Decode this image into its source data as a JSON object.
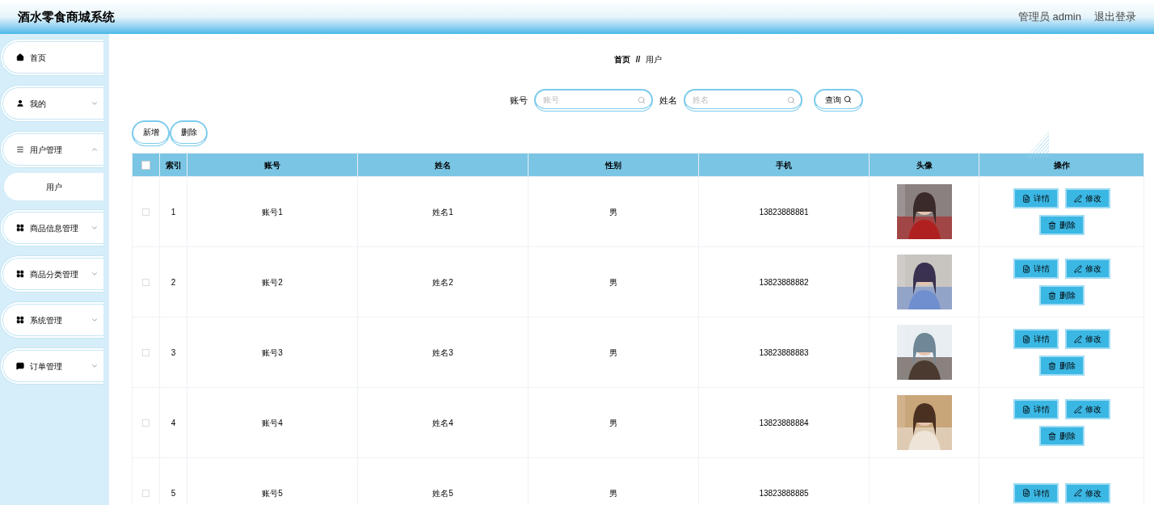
{
  "header": {
    "title": "酒水零食商城系统",
    "user": "管理员 admin",
    "logout": "退出登录"
  },
  "sidebar": {
    "items": [
      {
        "label": "首页"
      },
      {
        "label": "我的",
        "expanded": false
      },
      {
        "label": "用户管理",
        "expanded": true,
        "children": [
          {
            "label": "用户",
            "selected": true
          }
        ]
      },
      {
        "label": "商品信息管理",
        "expanded": false
      },
      {
        "label": "商品分类管理",
        "expanded": false
      },
      {
        "label": "系统管理",
        "expanded": false
      },
      {
        "label": "订单管理",
        "expanded": false
      }
    ]
  },
  "breadcrumb": [
    "首页",
    "//",
    "用户"
  ],
  "search": {
    "fields": [
      {
        "label": "账号",
        "placeholder": "账号"
      },
      {
        "label": "姓名",
        "placeholder": "姓名"
      }
    ],
    "button": "查询"
  },
  "actions": [
    "新增",
    "删除"
  ],
  "table": {
    "select_all": {
      "checked": false
    },
    "columns": [
      "索引",
      "账号",
      "姓名",
      "性别",
      "手机",
      "头像",
      "操作"
    ],
    "rows": [
      {
        "checked": false,
        "cells": [
          "1",
          "账号1",
          "姓名1",
          "男",
          "13823888881"
        ],
        "buttons": [
          "详情",
          "修改",
          "删除"
        ]
      },
      {
        "checked": false,
        "cells": [
          "2",
          "账号2",
          "姓名2",
          "男",
          "13823888882"
        ],
        "buttons": [
          "详情",
          "修改",
          "删除"
        ]
      },
      {
        "checked": false,
        "cells": [
          "3",
          "账号3",
          "姓名3",
          "男",
          "13823888883"
        ],
        "buttons": [
          "详情",
          "修改",
          "删除"
        ]
      },
      {
        "checked": false,
        "cells": [
          "4",
          "账号4",
          "姓名4",
          "男",
          "13823888884"
        ],
        "buttons": [
          "详情",
          "修改",
          "删除"
        ]
      },
      {
        "checked": false,
        "cells": [
          "5",
          "账号5",
          "姓名5",
          "男",
          "13823888885"
        ],
        "buttons": [
          "详情",
          "修改"
        ]
      }
    ]
  }
}
